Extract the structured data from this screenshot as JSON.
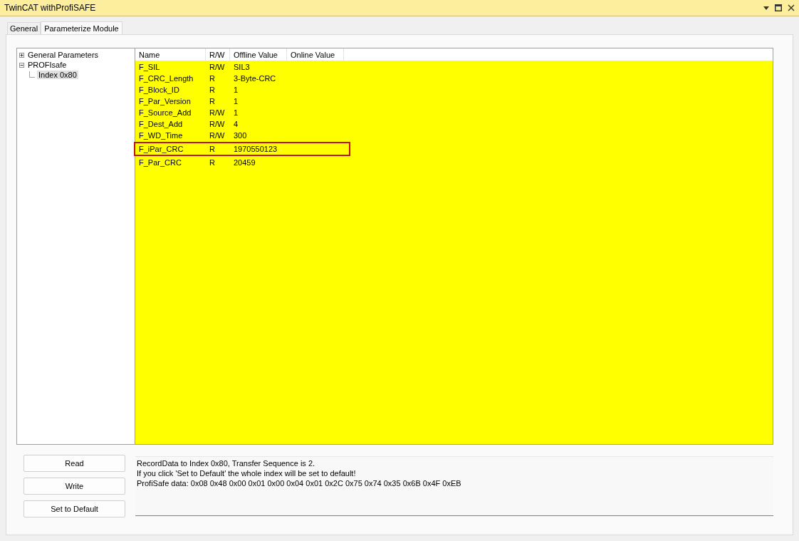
{
  "window": {
    "title": "TwinCAT withProfiSAFE"
  },
  "tabs": [
    {
      "label": "General",
      "selected": false
    },
    {
      "label": "Parameterize Module",
      "selected": true
    }
  ],
  "tree": [
    {
      "label": "General Parameters",
      "expanded": false,
      "selected": false
    },
    {
      "label": "PROFIsafe",
      "expanded": true,
      "selected": false,
      "children": [
        {
          "label": "Index 0x80",
          "selected": true
        }
      ]
    }
  ],
  "table": {
    "columns": [
      "Name",
      "R/W",
      "Offline Value",
      "Online Value"
    ],
    "rows": [
      {
        "name": "F_SIL",
        "rw": "R/W",
        "offline": "SIL3",
        "highlighted": false
      },
      {
        "name": "F_CRC_Length",
        "rw": "R",
        "offline": "3-Byte-CRC",
        "highlighted": false
      },
      {
        "name": "F_Block_ID",
        "rw": "R",
        "offline": "1",
        "highlighted": false
      },
      {
        "name": "F_Par_Version",
        "rw": "R",
        "offline": "1",
        "highlighted": false
      },
      {
        "name": "F_Source_Add",
        "rw": "R/W",
        "offline": "1",
        "highlighted": false
      },
      {
        "name": "F_Dest_Add",
        "rw": "R/W",
        "offline": "4",
        "highlighted": false
      },
      {
        "name": "F_WD_Time",
        "rw": "R/W",
        "offline": "300",
        "highlighted": false
      },
      {
        "name": "F_iPar_CRC",
        "rw": "R",
        "offline": "1970550123",
        "highlighted": true
      },
      {
        "name": "F_Par_CRC",
        "rw": "R",
        "offline": "20459",
        "highlighted": false
      }
    ]
  },
  "buttons": [
    "Read",
    "Write",
    "Set to Default"
  ],
  "messages": [
    "RecordData to Index 0x80, Transfer Sequence is 2.",
    "If you click 'Set to Default' the whole index will be set to default!",
    "ProfiSafe data: 0x08 0x48 0x00 0x01 0x00 0x04 0x01 0x2C 0x75 0x74 0x35 0x6B 0x4F 0xEB"
  ]
}
